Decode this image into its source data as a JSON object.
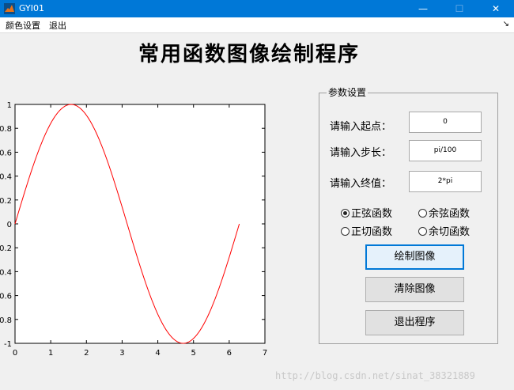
{
  "window": {
    "title": "GYI01",
    "minimize": "—",
    "maximize": "☐",
    "close": "✕"
  },
  "menu": {
    "items": [
      "颜色设置",
      "退出"
    ],
    "dock_arrow": "↘"
  },
  "page_title": "常用函数图像绘制程序",
  "chart_data": {
    "type": "line",
    "series": [
      {
        "function": "sin(x)",
        "start": 0,
        "step": "pi/100",
        "end": "2*pi",
        "color": "#ff0000"
      }
    ],
    "xlim": [
      0,
      7
    ],
    "ylim": [
      -1,
      1
    ],
    "xticks": [
      "0",
      "1",
      "2",
      "3",
      "4",
      "5",
      "6",
      "7"
    ],
    "yticks": [
      "-1",
      "-0.8",
      "-0.6",
      "-0.4",
      "-0.2",
      "0",
      "0.2",
      "0.4",
      "0.6",
      "0.8",
      "1"
    ],
    "ytick_values": [
      -1,
      -0.8,
      -0.6,
      -0.4,
      -0.2,
      0,
      0.2,
      0.4,
      0.6,
      0.8,
      1
    ],
    "grid": false
  },
  "panel": {
    "legend": "参数设置",
    "start_label": "请输入起点：",
    "start_value": "0",
    "step_label": "请输入步长：",
    "step_value": "pi/100",
    "end_label": "请输入终值：",
    "end_value": "2*pi",
    "radios": [
      {
        "label": "正弦函数",
        "checked": true
      },
      {
        "label": "余弦函数",
        "checked": false
      },
      {
        "label": "正切函数",
        "checked": false
      },
      {
        "label": "余切函数",
        "checked": false
      }
    ],
    "draw_button": "绘制图像",
    "clear_button": "清除图像",
    "exit_button": "退出程序"
  },
  "watermark": "http://blog.csdn.net/sinat_38321889"
}
